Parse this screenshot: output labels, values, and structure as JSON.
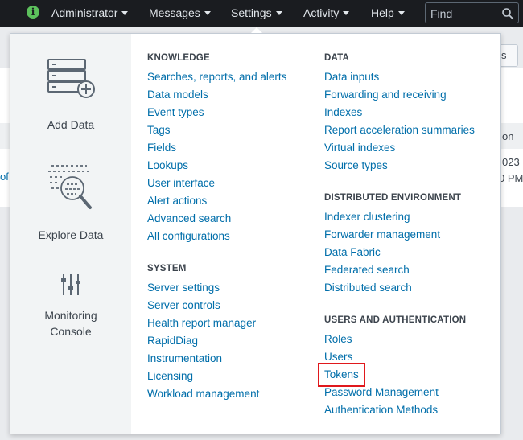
{
  "topbar": {
    "nav": [
      {
        "label": "Administrator"
      },
      {
        "label": "Messages"
      },
      {
        "label": "Settings"
      },
      {
        "label": "Activity"
      },
      {
        "label": "Help"
      }
    ],
    "find_placeholder": "Find"
  },
  "background": {
    "button_tail": "s",
    "column_tail": "on",
    "cell_tail_1": "023",
    "cell_tail_2": "0 PM",
    "left_tail": "of"
  },
  "apps": [
    {
      "label": "Add Data",
      "icon": "add-data-icon"
    },
    {
      "label": "Explore Data",
      "icon": "explore-data-icon"
    },
    {
      "label_line1": "Monitoring",
      "label_line2": "Console",
      "icon": "monitoring-console-icon"
    }
  ],
  "knowledge": {
    "title": "KNOWLEDGE",
    "items": [
      "Searches, reports, and alerts",
      "Data models",
      "Event types",
      "Tags",
      "Fields",
      "Lookups",
      "User interface",
      "Alert actions",
      "Advanced search",
      "All configurations"
    ]
  },
  "system": {
    "title": "SYSTEM",
    "items": [
      "Server settings",
      "Server controls",
      "Health report manager",
      "RapidDiag",
      "Instrumentation",
      "Licensing",
      "Workload management"
    ]
  },
  "data": {
    "title": "DATA",
    "items": [
      "Data inputs",
      "Forwarding and receiving",
      "Indexes",
      "Report acceleration summaries",
      "Virtual indexes",
      "Source types"
    ]
  },
  "distributed": {
    "title": "DISTRIBUTED ENVIRONMENT",
    "items": [
      "Indexer clustering",
      "Forwarder management",
      "Data Fabric",
      "Federated search",
      "Distributed search"
    ]
  },
  "users_auth": {
    "title": "USERS AND AUTHENTICATION",
    "items": [
      "Roles",
      "Users",
      "Tokens",
      "Password Management",
      "Authentication Methods"
    ]
  },
  "colors": {
    "link": "#006eaa",
    "highlight": "#e0181c",
    "topbar": "#1a1c20",
    "info_green": "#5cc05c"
  }
}
